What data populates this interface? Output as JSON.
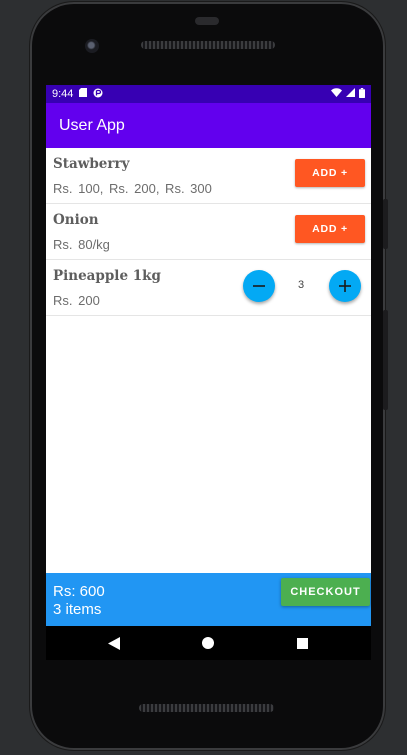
{
  "status_bar": {
    "time": "9:44",
    "icons": [
      "sd-card-icon",
      "app-notification-icon",
      "wifi-icon",
      "signal-icon",
      "battery-icon"
    ]
  },
  "app_bar": {
    "title": "User App"
  },
  "products": [
    {
      "name": "Stawberry",
      "price": "Rs. 100, Rs. 200, Rs. 300",
      "action_label": "ADD +"
    },
    {
      "name": "Onion",
      "price": "Rs. 80/kg",
      "action_label": "ADD +"
    },
    {
      "name": "Pineapple 1kg",
      "price": "Rs. 200",
      "quantity": "3",
      "stepper_icons": [
        "minus-icon",
        "plus-icon"
      ]
    }
  ],
  "cart": {
    "total": "Rs: 600",
    "count": "3 items",
    "checkout_label": "CHECKOUT"
  },
  "nav": {
    "icons": [
      "back-icon",
      "home-icon",
      "recents-icon"
    ]
  },
  "colors": {
    "status_bar": "#3700b3",
    "app_bar": "#6200ee",
    "add_button": "#ff5722",
    "stepper": "#03a9f4",
    "bottom_bar": "#2196f3",
    "checkout": "#4caf50"
  }
}
